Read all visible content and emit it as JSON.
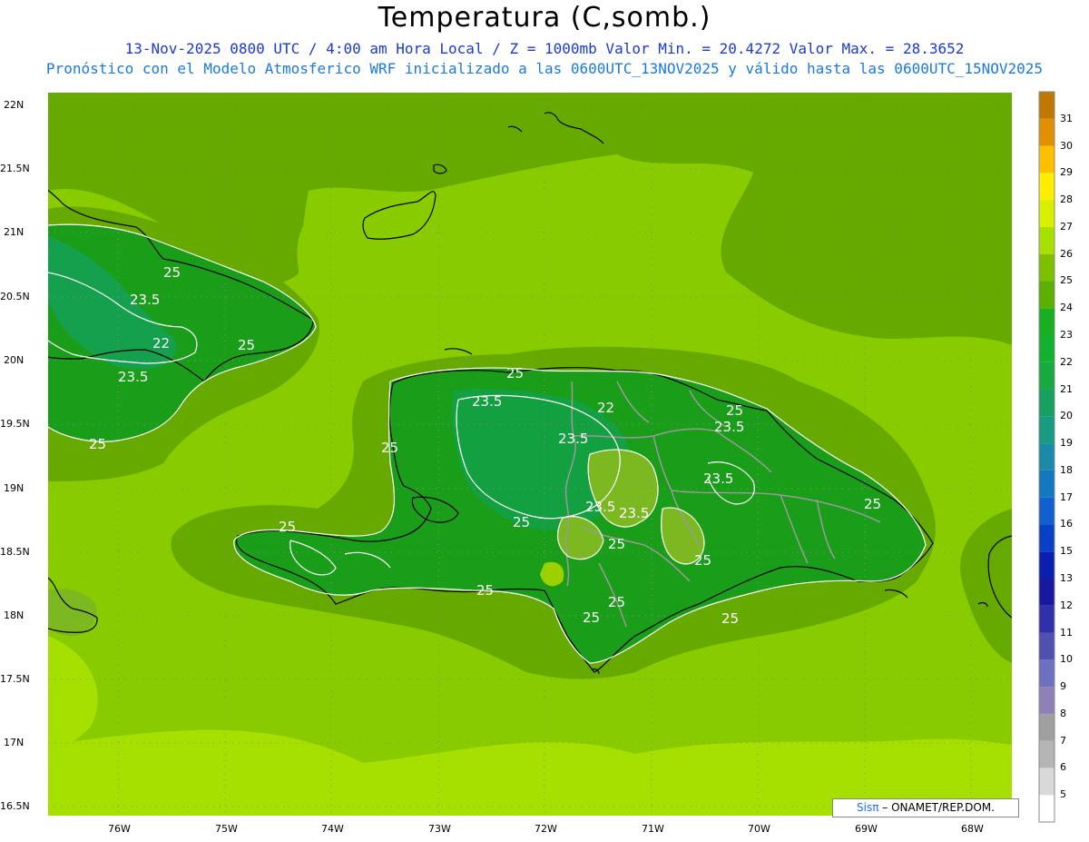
{
  "header": {
    "title": "Temperatura (C,somb.)",
    "line1": "13-Nov-2025 0800 UTC / 4:00 am Hora Local / Z = 1000mb   Valor Min. = 20.4272  Valor Max. = 28.3652",
    "line2": "Pronóstico con el Modelo Atmosferico WRF inicializado a las 0600UTC_13NOV2025 y válido hasta las  0600UTC_15NOV2025"
  },
  "axes": {
    "lat_labels": [
      "22N",
      "21.5N",
      "21N",
      "20.5N",
      "20N",
      "19.5N",
      "19N",
      "18.5N",
      "18N",
      "17.5N",
      "17N",
      "16.5N"
    ],
    "lon_labels": [
      "76W",
      "75W",
      "74W",
      "73W",
      "72W",
      "71W",
      "70W",
      "69W",
      "68W"
    ]
  },
  "colorbar": {
    "levels": [
      "5",
      "6",
      "7",
      "8",
      "9",
      "10",
      "11",
      "12",
      "13",
      "15",
      "16",
      "17",
      "18",
      "19",
      "20",
      "21",
      "22",
      "23",
      "24",
      "25",
      "26",
      "27",
      "28",
      "29",
      "30",
      "31"
    ],
    "colors": [
      "#ffffff",
      "#d9d9d9",
      "#b5b5b5",
      "#a0a0a0",
      "#9080b8",
      "#7070c0",
      "#5050b0",
      "#3030a8",
      "#1818a0",
      "#0a1fb0",
      "#0a40c8",
      "#1060d0",
      "#1478c0",
      "#1a8aa8",
      "#1a9a80",
      "#18a060",
      "#16aa40",
      "#14b030",
      "#18b020",
      "#5cb000",
      "#7cc000",
      "#a8e000",
      "#d8f000",
      "#ffee00",
      "#ffc000",
      "#e09000",
      "#c07800"
    ]
  },
  "contours": {
    "labels": [
      "25",
      "23.5",
      "22",
      "25",
      "23.5",
      "25",
      "25",
      "23.5",
      "22",
      "25",
      "23.5",
      "25",
      "23.5",
      "23.5",
      "23.5",
      "23.5",
      "25",
      "25",
      "25",
      "25",
      "25",
      "25",
      "25",
      "25",
      "25"
    ]
  },
  "credit": {
    "sis": "Sisπ",
    "org": "– ONAMET/REP.DOM."
  }
}
